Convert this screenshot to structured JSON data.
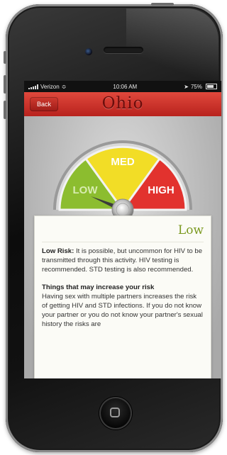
{
  "status_bar": {
    "carrier": "Verizon",
    "time": "10:06 AM",
    "battery": "75%"
  },
  "nav": {
    "back_label": "Back",
    "title": "Ohio"
  },
  "gauge": {
    "segments": [
      {
        "label": "LOW",
        "color": "#8cbd2f"
      },
      {
        "label": "MED",
        "color": "#f2dd26"
      },
      {
        "label": "HIGH",
        "color": "#e2322e"
      }
    ],
    "selected": "LOW"
  },
  "result": {
    "rating": "Low",
    "risk_title": "Low Risk:",
    "risk_text": " It is possible, but uncommon for HIV to be transmitted through this activity. HIV testing is recommended. STD testing is also recommended.",
    "increase_heading": "Things that may increase your risk",
    "increase_text": "Having sex with multiple partners increases the risk of getting HIV and STD infections. If you do not know your partner or you do not know your partner's sexual history the risks are"
  },
  "colors": {
    "nav_red": "#c8302a",
    "rating_green": "#7c9a22"
  }
}
